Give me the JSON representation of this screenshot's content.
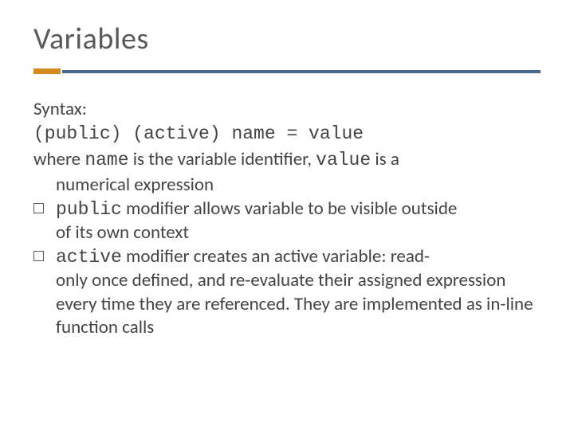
{
  "title": "Variables",
  "syntax_label": "Syntax:",
  "syntax_line": "(public) (active) name = value",
  "where_prefix": "where ",
  "where_name": "name",
  "where_mid": " is the variable identifier, ",
  "where_value": "value",
  "where_suffix": " is a",
  "where_cont": "numerical expression",
  "bullets": [
    {
      "code": "public",
      "rest_first": " modifier allows variable to be visible outside",
      "cont": "of its own context"
    },
    {
      "code": "active",
      "rest_first": " modifier creates an active variable: read-",
      "cont": "only once defined, and re-evaluate their assigned expression every time they are referenced. They are implemented as in-line function calls"
    }
  ]
}
